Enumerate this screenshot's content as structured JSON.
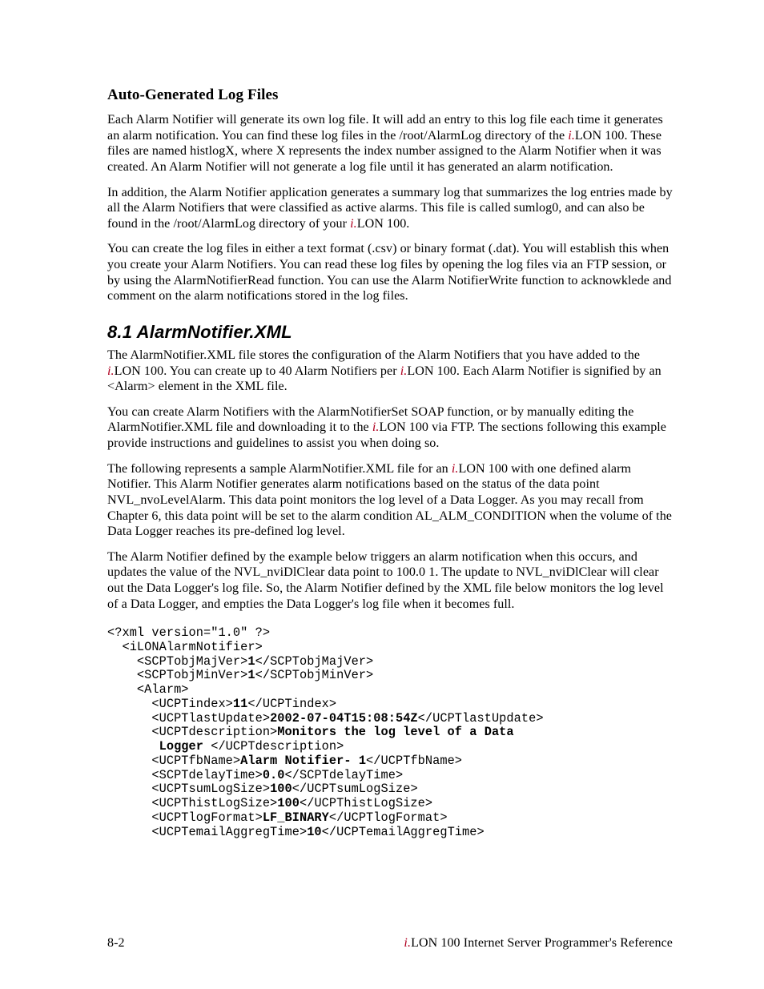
{
  "section1_title": "Auto-Generated Log Files",
  "p1_a": "Each Alarm Notifier will generate its own log file. It will add an entry to this log file each time it generates an alarm notification. You can find these log files in the /root/AlarmLog directory of the ",
  "p1_i": "i.",
  "p1_b": "LON 100. These files are named histlogX, where X represents the index number assigned to the Alarm Notifier when it was created. An Alarm Notifier will not generate a log file until it has generated an alarm notification.",
  "p2_a": "In addition, the Alarm Notifier application generates a summary log that summarizes the log entries made by all the Alarm Notifiers that were classified as active alarms. This file is called sumlog0, and can also be found in the /root/AlarmLog directory of your ",
  "p2_i": "i.",
  "p2_b": "LON 100.",
  "p3": "You can create the log files in either a text format (.csv) or binary format (.dat). You will establish this when you create your Alarm Notifiers. You can read these log files by opening the log files via an FTP session, or by using the AlarmNotifierRead function. You can use the Alarm NotifierWrite function to acknowklede and comment on the alarm notifications stored in the log files.",
  "section2_title": "8.1  AlarmNotifier.XML",
  "p4_a": "The AlarmNotifier.XML file stores the configuration of the Alarm Notifiers that you have added to the ",
  "p4_i1": "i.",
  "p4_b": "LON 100. You can create up to 40 Alarm Notifiers per ",
  "p4_i2": "i.",
  "p4_c": "LON 100. Each Alarm Notifier is signified by an <Alarm> element in the XML file.",
  "p5_a": "You can create Alarm Notifiers with the AlarmNotifierSet SOAP function, or by manually editing the AlarmNotifier.XML file and downloading it to the ",
  "p5_i": "i.",
  "p5_b": "LON 100 via FTP. The sections following this example provide instructions and guidelines to assist you when doing so.",
  "p6_a": "The following represents a sample AlarmNotifier.XML file for an ",
  "p6_i": "i.",
  "p6_b": "LON 100 with one defined alarm Notifier. This Alarm Notifier generates alarm notifications based on the status of the data point NVL_nvoLevelAlarm. This data point monitors the log level of a Data Logger. As you may recall from Chapter 6, this data point will be set to the alarm condition AL_ALM_CONDITION when the volume of the Data Logger reaches its pre-defined log level.",
  "p7": "The Alarm Notifier defined by the example below triggers an alarm notification when this occurs, and updates the value of the NVL_nviDlClear data point to 100.0 1. The update to NVL_nviDlClear will clear out the Data Logger's log file. So, the Alarm Notifier defined by the XML file below monitors the log level of a Data Logger, and empties the Data Logger's log file when it becomes full.",
  "xml": {
    "l0": "<?xml version=\"1.0\" ?>",
    "l1": "  <iLONAlarmNotifier>",
    "l2": "    <SCPTobjMajVer>",
    "v2": "1",
    "l2e": "</SCPTobjMajVer>",
    "l3": "    <SCPTobjMinVer>",
    "v3": "1",
    "l3e": "</SCPTobjMinVer>",
    "l4": "    <Alarm>",
    "l5": "      <UCPTindex>",
    "v5": "11",
    "l5e": "</UCPTindex>",
    "l6": "      <UCPTlastUpdate>",
    "v6": "2002-07-04T15:08:54Z",
    "l6e": "</UCPTlastUpdate>",
    "l7": "      <UCPTdescription>",
    "v7a": "Monitors the log level of a Data",
    "v7b": "       Logger ",
    "l7e": "</UCPTdescription>",
    "l8": "      <UCPTfbName>",
    "v8": "Alarm Notifier- 1",
    "l8e": "</UCPTfbName>",
    "l9": "      <SCPTdelayTime>",
    "v9": "0.0",
    "l9e": "</SCPTdelayTime>",
    "l10": "      <UCPTsumLogSize>",
    "v10": "100",
    "l10e": "</UCPTsumLogSize>",
    "l11": "      <UCPThistLogSize>",
    "v11": "100",
    "l11e": "</UCPThistLogSize>",
    "l12": "      <UCPTlogFormat>",
    "v12": "LF_BINARY",
    "l12e": "</UCPTlogFormat>",
    "l13": "      <UCPTemailAggregTime>",
    "v13": "10",
    "l13e": "</UCPTemailAggregTime>"
  },
  "footer_page": "8-2",
  "footer_ref_i": "i.",
  "footer_ref_rest": "LON 100 Internet Server Programmer's Reference"
}
